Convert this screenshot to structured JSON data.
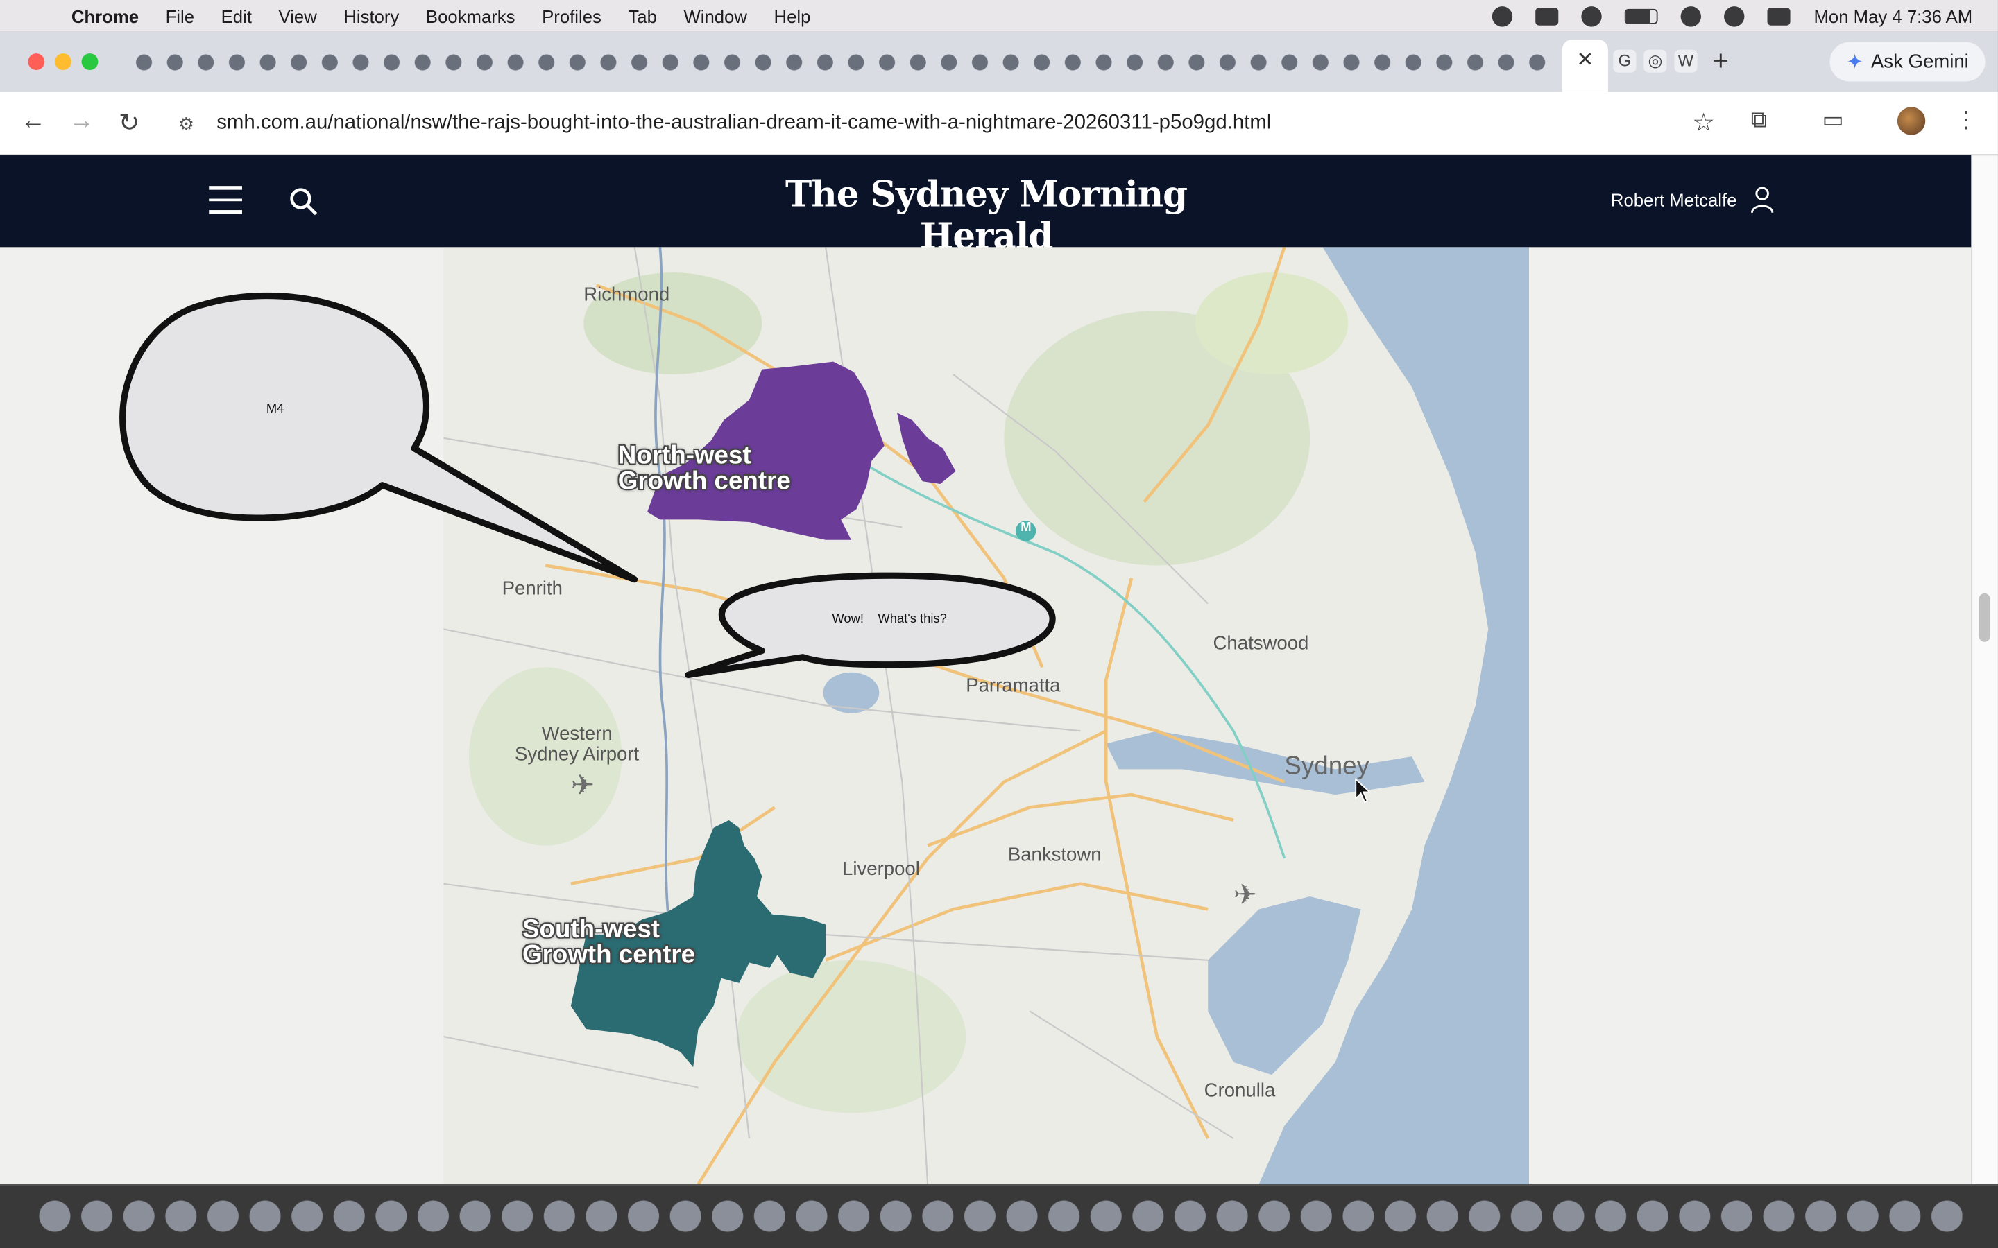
{
  "menubar": {
    "app": "Chrome",
    "items": [
      "File",
      "Edit",
      "View",
      "History",
      "Bookmarks",
      "Profiles",
      "Tab",
      "Window",
      "Help"
    ],
    "clock": "Mon May 4  7:36 AM"
  },
  "tabs": {
    "active_close": "✕",
    "new_tab": "+",
    "extra": [
      "G",
      "◎",
      "W"
    ]
  },
  "gemini": {
    "label": "Ask Gemini"
  },
  "address": {
    "url": "smh.com.au/national/nsw/the-rajs-bought-into-the-australian-dream-it-came-with-a-nightmare-20260311-p5o9gd.html"
  },
  "site": {
    "masthead": "The Sydney Morning Herald",
    "user": "Robert Metcalfe"
  },
  "map": {
    "places": {
      "richmond": "Richmond",
      "penrith": "Penrith",
      "parramatta": "Parramatta",
      "chatswood": "Chatswood",
      "sydney": "Sydney",
      "western_airport": "Western\nSydney Airport",
      "liverpool": "Liverpool",
      "bankstown": "Bankstown",
      "cronulla": "Cronulla",
      "metro": "M"
    },
    "regions": {
      "northwest": {
        "line1": "North-west",
        "line2": "Growth centre",
        "color": "#6b3d98"
      },
      "southwest": {
        "line1": "South-west",
        "line2": "Growth centre",
        "color": "#2b6b72"
      }
    }
  },
  "bubbles": {
    "m4": "M4",
    "wow": "Wow!    What's this?"
  }
}
